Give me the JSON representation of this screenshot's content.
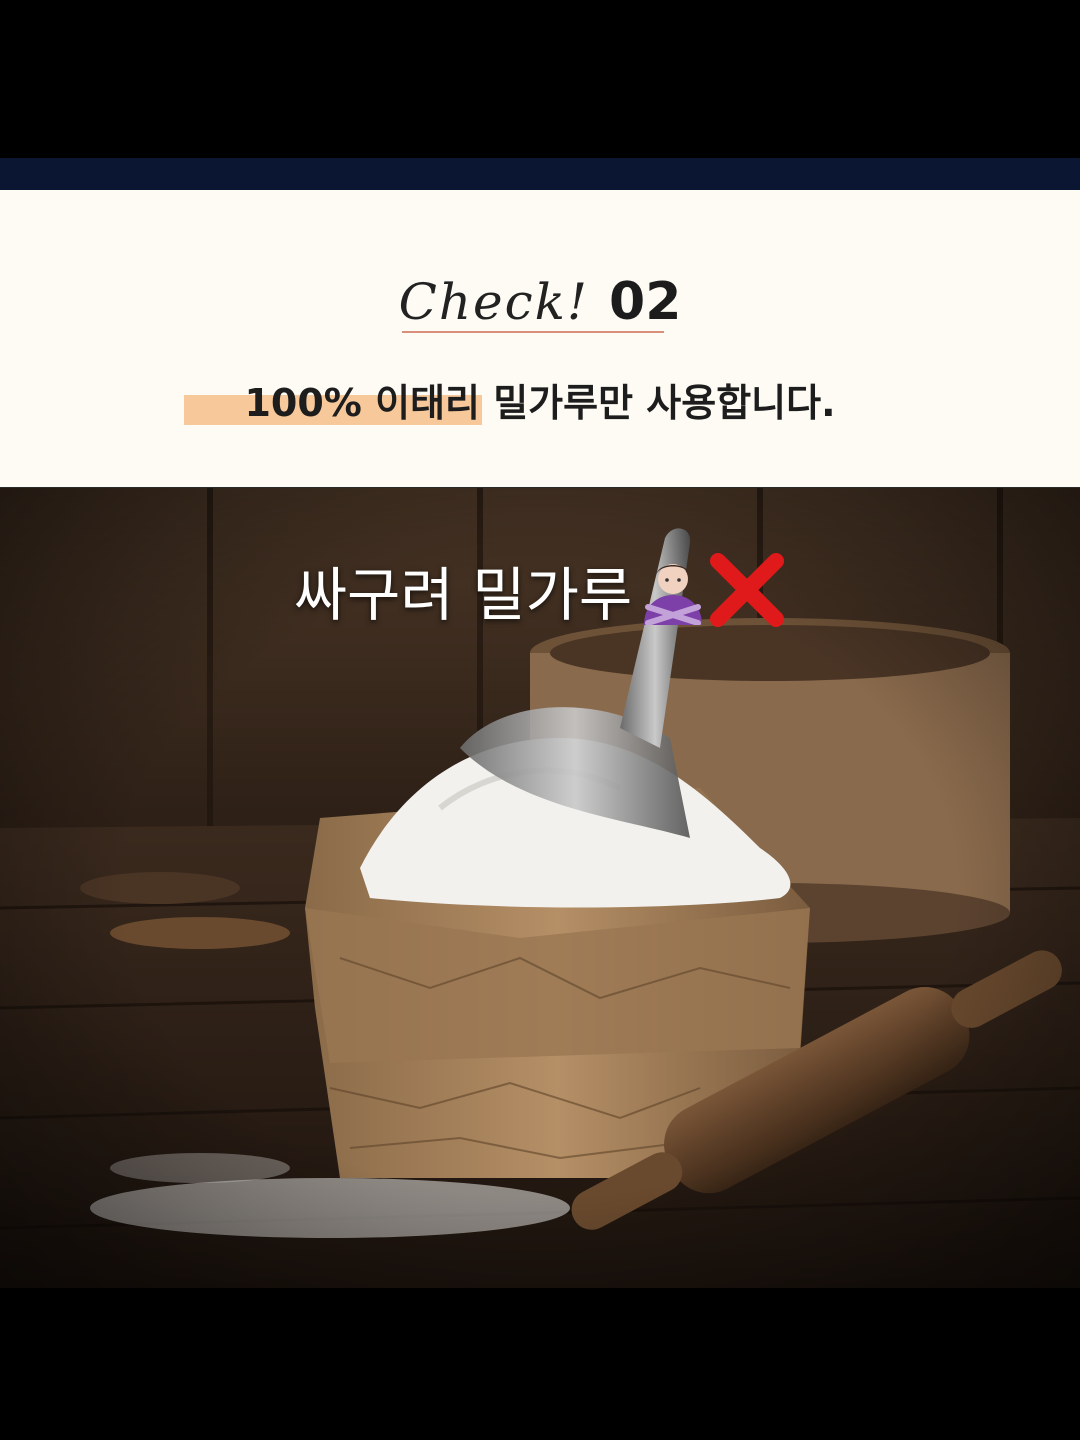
{
  "header": {
    "check_label": "Check!",
    "check_number": "02",
    "subtitle_highlight": "100% 이태리",
    "subtitle_rest": " 밀가루만 사용합니다."
  },
  "photo": {
    "overlay_caption": "싸구려 밀가루",
    "emoji_icons": [
      "person-gesturing-no-icon",
      "red-x-icon"
    ]
  },
  "colors": {
    "navy_band": "#0b1633",
    "panel_bg": "#fdfbf3",
    "highlight": "#f6c89a",
    "underline": "#d9907a",
    "x_red": "#e01a1a"
  }
}
